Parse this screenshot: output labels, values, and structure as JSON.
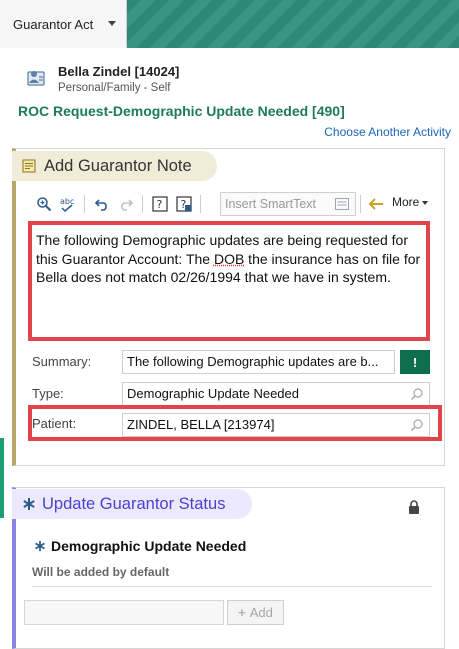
{
  "tab": {
    "label": "Guarantor Act"
  },
  "patient": {
    "name": "Bella Zindel [14024]",
    "relation": "Personal/Family - Self"
  },
  "activity": {
    "title": "ROC Request-Demographic Update Needed [490]",
    "choose_link": "Choose Another Activity"
  },
  "note_panel": {
    "title": "Add Guarantor Note",
    "toolbar": {
      "smarttext_placeholder": "Insert SmartText",
      "more_label": "More"
    },
    "note_text_before": "The following Demographic updates are being requested for this Guarantor Account: The ",
    "note_text_flagged": "DOB",
    "note_text_after": " the insurance has on file for Bella does not match 02/26/1994 that we have in system.",
    "summary_label": "Summary:",
    "summary_value": "The following Demographic updates are b...",
    "summary_button": "!",
    "type_label": "Type:",
    "type_value": "Demographic Update Needed",
    "patient_label": "Patient:",
    "patient_value": "ZINDEL, BELLA [213974]"
  },
  "status_panel": {
    "title": "Update Guarantor Status",
    "status_name": "Demographic Update Needed",
    "status_sub": "Will be added by default",
    "add_button": "Add"
  },
  "colors": {
    "tab_bar": "#2f8e7c",
    "activity_title": "#1d7a5c",
    "link": "#1a66b8",
    "highlight_box": "#e0454b",
    "status_accent": "#4c3fd1",
    "note_accent": "#b8a66a"
  },
  "icons": {
    "patient": "patient-card-icon",
    "note": "note-icon",
    "status": "asterisk-icon",
    "lock": "lock-icon"
  }
}
